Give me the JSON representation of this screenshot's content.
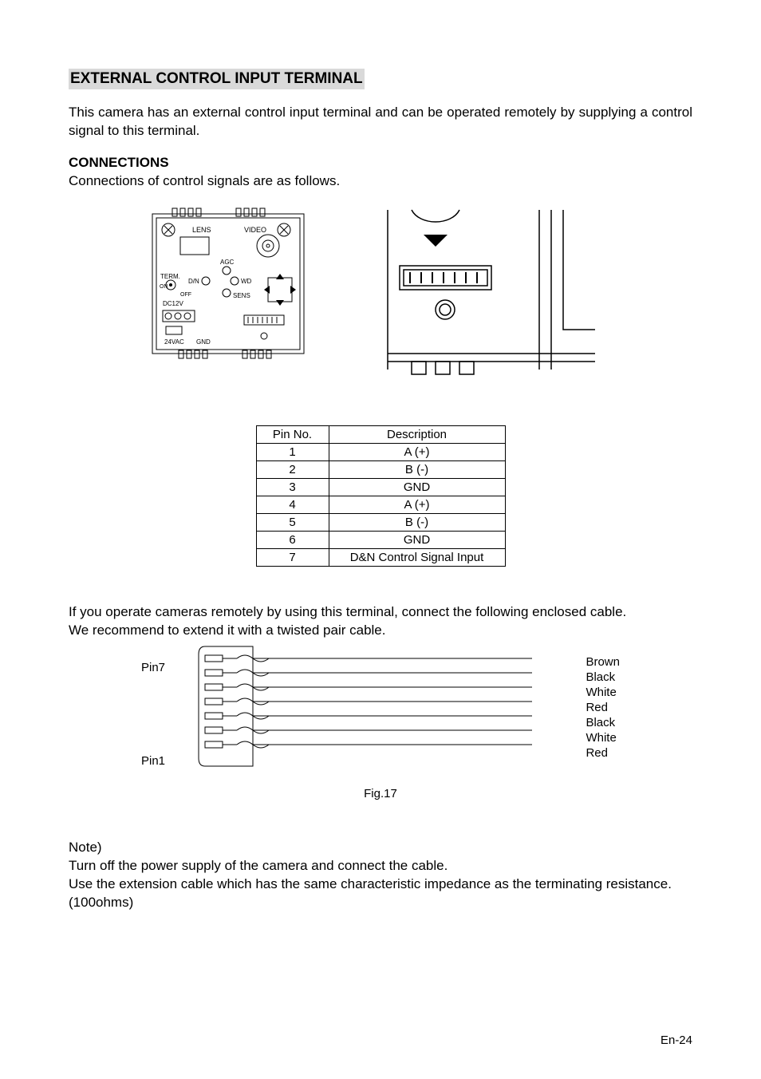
{
  "section_title": "EXTERNAL CONTROL INPUT TERMINAL",
  "intro": "This camera has an external control input terminal and can be operated remotely by supplying a control signal to this terminal.",
  "connections_heading": "CONNECTIONS",
  "connections_intro": "Connections of control signals are as follows.",
  "back_panel_labels": {
    "lens": "LENS",
    "video": "VIDEO",
    "agc": "AGC",
    "term": "TERM.",
    "dn": "D/N",
    "wd": "WD",
    "on": "ON",
    "off": "OFF",
    "sens": "SENS",
    "dc12v": "DC12V",
    "ac24v": "24VAC",
    "gnd": "GND"
  },
  "pin_table": {
    "headers": {
      "pin": "Pin No.",
      "desc": "Description"
    },
    "rows": [
      {
        "pin": "1",
        "desc": "A (+)"
      },
      {
        "pin": "2",
        "desc": "B (-)"
      },
      {
        "pin": "3",
        "desc": "GND"
      },
      {
        "pin": "4",
        "desc": "A (+)"
      },
      {
        "pin": "5",
        "desc": "B (-)"
      },
      {
        "pin": "6",
        "desc": "GND"
      },
      {
        "pin": "7",
        "desc": "D&N Control Signal Input"
      }
    ]
  },
  "remote_text_1": "If you operate cameras remotely by using this terminal, connect the following enclosed cable.",
  "remote_text_2": "We recommend to extend it with a twisted pair cable.",
  "cable": {
    "left_top": "Pin7",
    "left_bottom": "Pin1",
    "colors": [
      "Brown",
      "Black",
      "White",
      "Red",
      "Black",
      "White",
      "Red"
    ]
  },
  "fig_caption": "Fig.17",
  "note_heading": "Note)",
  "note_line1": "Turn off the power supply of the camera and connect the cable.",
  "note_line2": "Use the extension cable which has the same characteristic impedance as the terminating resistance.",
  "note_line3": "(100ohms)",
  "page_number": "En-24"
}
